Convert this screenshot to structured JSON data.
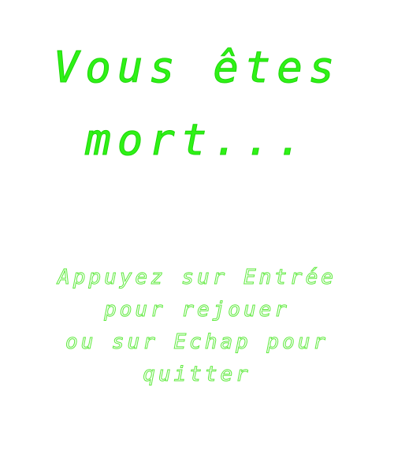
{
  "game_over": {
    "title_lines": [
      "Vous êtes",
      "mort..."
    ],
    "instruction_lines": [
      "Appuyez sur Entrée",
      "pour rejouer",
      "ou sur Echap pour",
      "quitter"
    ]
  },
  "colors": {
    "background": "#ffffff",
    "title_green": "#2ef216",
    "instruction_green": "#5fea3e"
  }
}
